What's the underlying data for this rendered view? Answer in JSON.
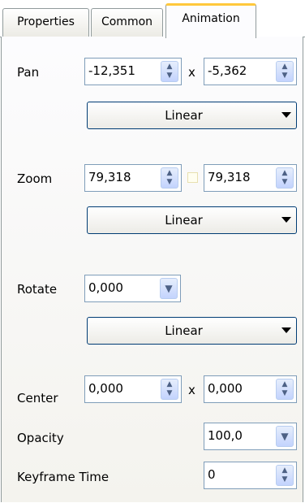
{
  "tabs": [
    {
      "label": "Properties"
    },
    {
      "label": "Common"
    },
    {
      "label": "Animation"
    }
  ],
  "active_tab": "Animation",
  "pan": {
    "label": "Pan",
    "x": "-12,351",
    "separator": "x",
    "y": "-5,362",
    "interpolation": "Linear"
  },
  "zoom": {
    "label": "Zoom",
    "x": "79,318",
    "y": "79,318",
    "lock_checked": false,
    "interpolation": "Linear"
  },
  "rotate": {
    "label": "Rotate",
    "value": "0,000",
    "interpolation": "Linear"
  },
  "center": {
    "label": "Center",
    "x": "0,000",
    "separator": "x",
    "y": "0,000"
  },
  "opacity": {
    "label": "Opacity",
    "value": "100,0"
  },
  "keyframe_time": {
    "label": "Keyframe Time",
    "value": "0"
  },
  "icons": {
    "spin": "up-down-spinner-icon",
    "dropdown": "chevron-down-icon",
    "combo_arrow": "triangle-down-icon"
  }
}
